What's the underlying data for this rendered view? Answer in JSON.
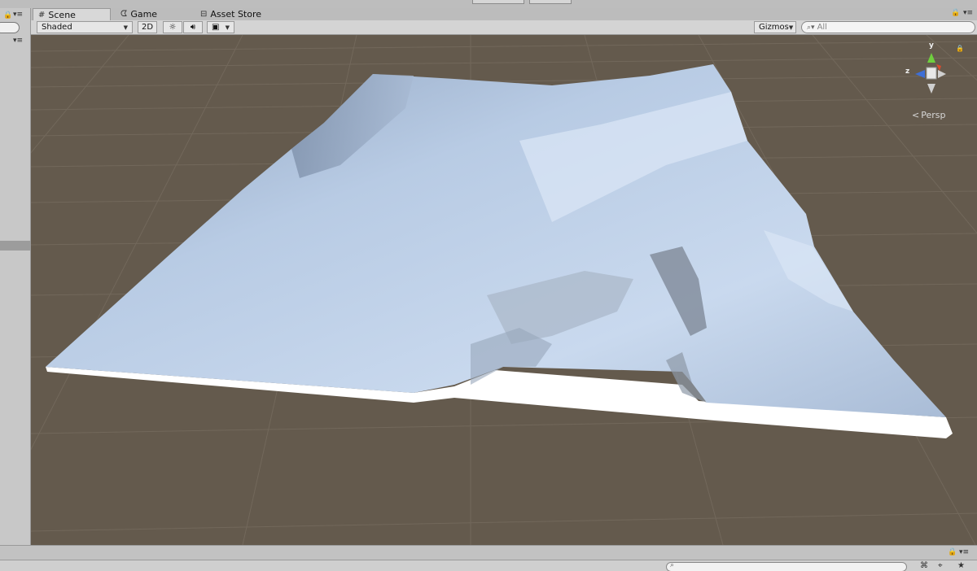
{
  "tabs": [
    {
      "label": "Scene",
      "icon": "grid-icon",
      "active": true
    },
    {
      "label": "Game",
      "icon": "pacman-icon",
      "active": false
    },
    {
      "label": "Asset Store",
      "icon": "store-bag-icon",
      "active": false
    }
  ],
  "toolbar": {
    "shading_mode": "Shaded",
    "mode_2d_label": "2D",
    "gizmos_label": "Gizmos",
    "search_placeholder": "All"
  },
  "viewport": {
    "background_color": "#645a4d",
    "terrain_color": "#b9cde6",
    "gizmo_axes": {
      "y": "y",
      "z": "z"
    },
    "projection_label": "Persp"
  },
  "icons": {
    "lock": "lock-icon",
    "menu": "context-menu-icon",
    "lighting": "sun-icon",
    "audio": "speaker-icon",
    "effects": "image-icon",
    "search": "magnifier-icon",
    "camera_back": "chevron-left-icon"
  }
}
